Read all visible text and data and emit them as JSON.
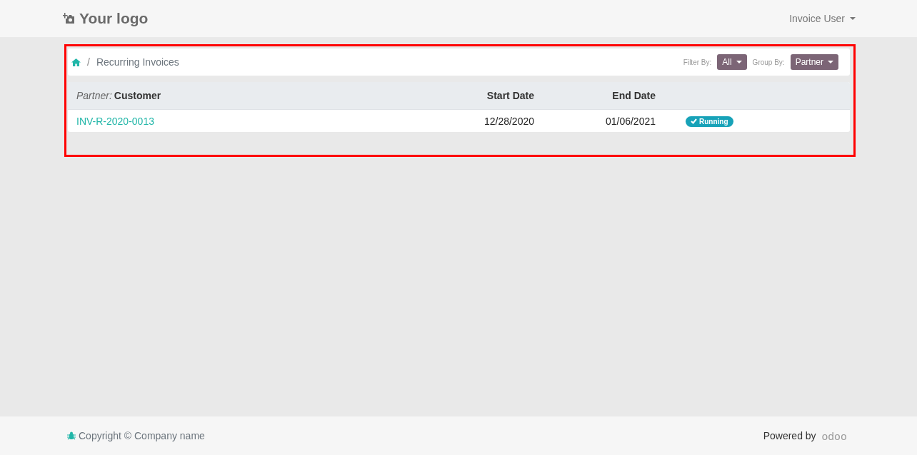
{
  "header": {
    "logo": "Your logo",
    "user_menu": "Invoice User"
  },
  "breadcrumb": {
    "separator": "/",
    "current": "Recurring Invoices"
  },
  "filters": [
    {
      "label": "Filter By:",
      "value": "All"
    },
    {
      "label": "Group By:",
      "value": "Partner"
    }
  ],
  "table": {
    "group_label": "Partner:",
    "group_value": "Customer",
    "columns": [
      "Start Date",
      "End Date"
    ],
    "rows": [
      {
        "reference": "INV-R-2020-0013",
        "start_date": "12/28/2020",
        "end_date": "01/06/2021",
        "status": {
          "label": "Running",
          "color": "#17a2b8"
        }
      }
    ]
  },
  "highlight": {
    "on": true
  },
  "footer": {
    "copyright": "Copyright © Company name",
    "powered_by": "Powered by",
    "brand": "odoo"
  }
}
